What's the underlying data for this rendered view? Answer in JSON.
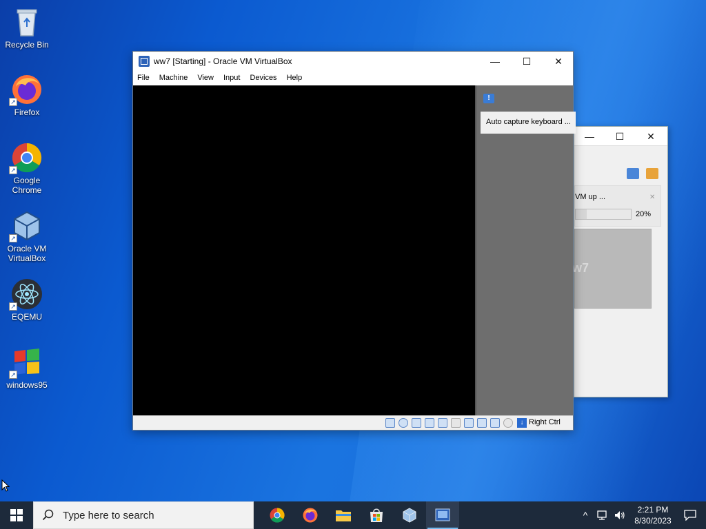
{
  "desktop": {
    "icons": [
      {
        "label": "Recycle Bin"
      },
      {
        "label": "Firefox"
      },
      {
        "label": "Google Chrome"
      },
      {
        "label": "Oracle VM VirtualBox"
      },
      {
        "label": "EQEMU"
      },
      {
        "label": "windows95"
      }
    ]
  },
  "vm_window": {
    "title": "ww7 [Starting] - Oracle VM VirtualBox",
    "menu": [
      "File",
      "Machine",
      "View",
      "Input",
      "Devices",
      "Help"
    ],
    "notification": "Auto capture keyboard ...",
    "host_key": "Right Ctrl"
  },
  "progress_window": {
    "operation_text": "VM up ...",
    "progress_percent": 20,
    "progress_label": "20%",
    "preview_text": "w7"
  },
  "taskbar": {
    "search_placeholder": "Type here to search",
    "time": "2:21 PM",
    "date": "8/30/2023"
  },
  "colors": {
    "taskbar_bg": "#1d2a3b",
    "accent": "#76b9ed",
    "desktop_blue": "#0b5ad0"
  }
}
